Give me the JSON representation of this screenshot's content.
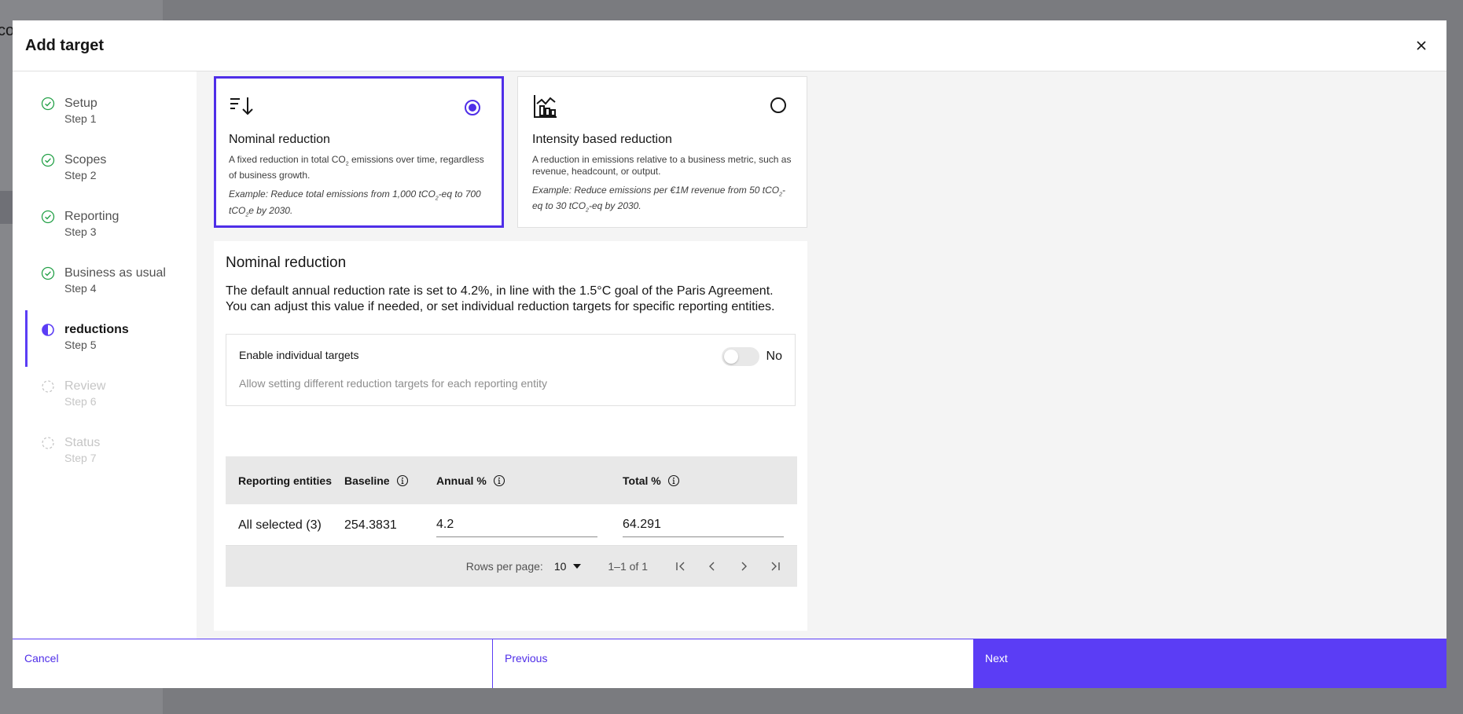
{
  "background": {
    "partial_text": "co"
  },
  "modal": {
    "title": "Add target"
  },
  "steps": [
    {
      "label": "Setup",
      "sub": "Step 1",
      "state": "complete"
    },
    {
      "label": "Scopes",
      "sub": "Step 2",
      "state": "complete"
    },
    {
      "label": "Reporting",
      "sub": "Step 3",
      "state": "complete"
    },
    {
      "label": "Business as usual",
      "sub": "Step 4",
      "state": "complete"
    },
    {
      "label": "reductions",
      "sub": "Step 5",
      "state": "current"
    },
    {
      "label": "Review",
      "sub": "Step 6",
      "state": "incomplete"
    },
    {
      "label": "Status",
      "sub": "Step 7",
      "state": "incomplete"
    }
  ],
  "cards": {
    "nominal": {
      "title": "Nominal reduction",
      "desc_a": "A fixed reduction in total CO",
      "desc_sub": "2",
      "desc_b": " emissions over time, regardless of business growth.",
      "ex_a": "Example: Reduce total emissions from 1,000 tCO",
      "ex_sub1": "2",
      "ex_b": "-eq to 700 tCO",
      "ex_sub2": "2",
      "ex_c": "e by 2030.",
      "selected": true
    },
    "intensity": {
      "title": "Intensity based reduction",
      "desc": "A reduction in emissions relative to a business metric, such as revenue, headcount, or output.",
      "ex_a": "Example: Reduce emissions per €1M revenue from 50 tCO",
      "ex_sub1": "2",
      "ex_b": "-eq to 30 tCO",
      "ex_sub2": "2",
      "ex_c": "-eq by 2030.",
      "selected": false
    }
  },
  "section": {
    "title": "Nominal reduction",
    "line1": "The default annual reduction rate is set to 4.2%, in line with the 1.5°C goal of the Paris Agreement.",
    "line2": "You can adjust this value if needed, or set individual reduction targets for specific reporting entities."
  },
  "toggle": {
    "label": "Enable individual targets",
    "state": "No",
    "helper": "Allow setting different reduction targets for each reporting entity"
  },
  "table": {
    "headers": {
      "entities": "Reporting entities",
      "baseline": "Baseline",
      "annual": "Annual %",
      "total": "Total %"
    },
    "rows": [
      {
        "entities": "All selected (3)",
        "baseline": "254.3831",
        "annual": "4.2",
        "total": "64.291"
      }
    ],
    "pagination": {
      "rows_label": "Rows per page:",
      "rows_value": "10",
      "range": "1–1 of 1"
    }
  },
  "footer": {
    "cancel": "Cancel",
    "previous": "Previous",
    "next": "Next"
  },
  "colors": {
    "accent": "#5b3df5",
    "success": "#24a148"
  }
}
